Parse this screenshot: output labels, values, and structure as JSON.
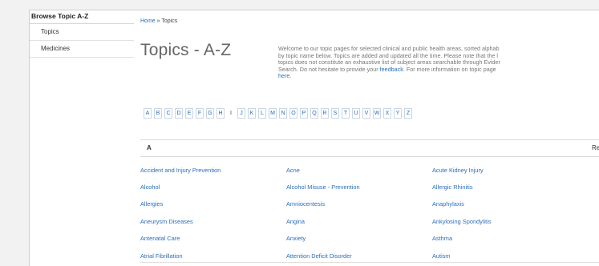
{
  "sidebar": {
    "title": "Browse Topic A-Z",
    "items": [
      "Topics",
      "Medicines"
    ]
  },
  "breadcrumb": {
    "home": "Home",
    "separator": "»",
    "current": "Topics"
  },
  "page": {
    "title": "Topics - A-Z"
  },
  "intro": {
    "line1": "Welcome to our topic pages for selected clinical and public health areas, sorted alphab",
    "line2": "by topic name below. Topics are added and updated all the time. Please note that the l",
    "line3": "topics does not constitute an exhaustive list of subject areas searchable through Evider",
    "line4_a": "Search. Do not hesitate to provide your ",
    "line4_link": "feedback",
    "line4_b": ". For more information on topic page",
    "line5": "here."
  },
  "az_letters": [
    "A",
    "B",
    "C",
    "D",
    "E",
    "F",
    "G",
    "H",
    "I",
    "J",
    "K",
    "L",
    "M",
    "N",
    "O",
    "P",
    "Q",
    "R",
    "S",
    "T",
    "U",
    "V",
    "W",
    "X",
    "Y",
    "Z"
  ],
  "section": {
    "letter": "A",
    "return_label": "Return"
  },
  "topics": {
    "col1": [
      "Accident and Injury Prevention",
      "Alcohol",
      "Allergies",
      "Aneurysm Diseases",
      "Antenatal Care",
      "Atrial Fibrillation"
    ],
    "col2": [
      "Acne",
      "Alcohol Misuse - Prevention",
      "Amniocentesis",
      "Angina",
      "Anxiety",
      "Attention Deficit Disorder"
    ],
    "col3": [
      "Acute Kidney Injury",
      "Allergic Rhinitis",
      "Anaphylaxis",
      "Ankylosing Spondylitis",
      "Asthma",
      "Autism"
    ]
  }
}
